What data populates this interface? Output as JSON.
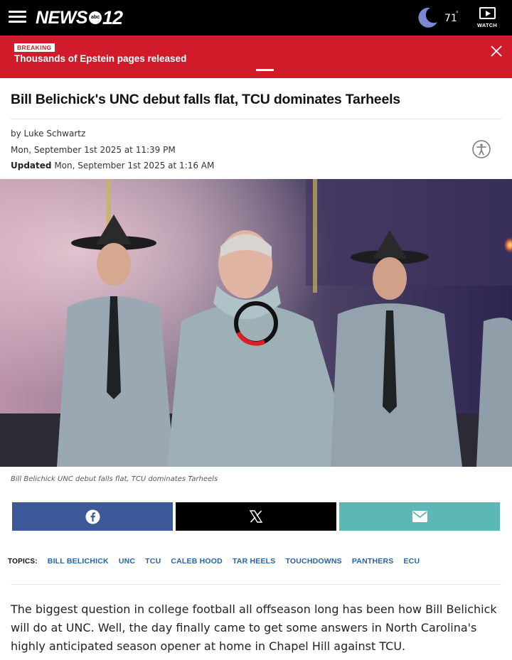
{
  "header": {
    "logo_news": "NEWS",
    "logo_abc": "abc",
    "logo_number": "12",
    "weather_temp": "71",
    "weather_degree": "°",
    "watch_label": "WATCH"
  },
  "breaking": {
    "tag": "BREAKING",
    "text": "Thousands of Epstein pages released"
  },
  "article": {
    "headline": "Bill Belichick's UNC debut falls flat, TCU dominates Tarheels",
    "byline": "by Luke Schwartz",
    "published": "Mon, September 1st 2025 at 11:39 PM",
    "updated_label": "Updated",
    "updated": " Mon, September 1st 2025 at 1:16 AM",
    "caption": "Bill Belichick UNC debut falls flat, TCU dominates Tarheels",
    "body": "The biggest question in college football all offseason long has been how Bill Belichick will do at UNC. Well, the day finally came to get some answers in North Carolina's highly anticipated season opener at home in Chapel Hill against TCU."
  },
  "share": {
    "facebook_icon": "facebook-icon",
    "x_icon": "x-icon",
    "email_icon": "email-icon",
    "colors": {
      "facebook": "#3b5998",
      "x": "#000000",
      "email": "#5cb8b5"
    }
  },
  "topics": {
    "label": "TOPICS:",
    "items": [
      "BILL BELICHICK",
      "UNC",
      "TCU",
      "CALEB HOOD",
      "TAR HEELS",
      "TOUCHDOWNS",
      "PANTHERS",
      "ECU"
    ]
  },
  "colors": {
    "brand_red": "#d11b2a",
    "link_blue": "#2563a8",
    "header_bg": "#000000"
  }
}
